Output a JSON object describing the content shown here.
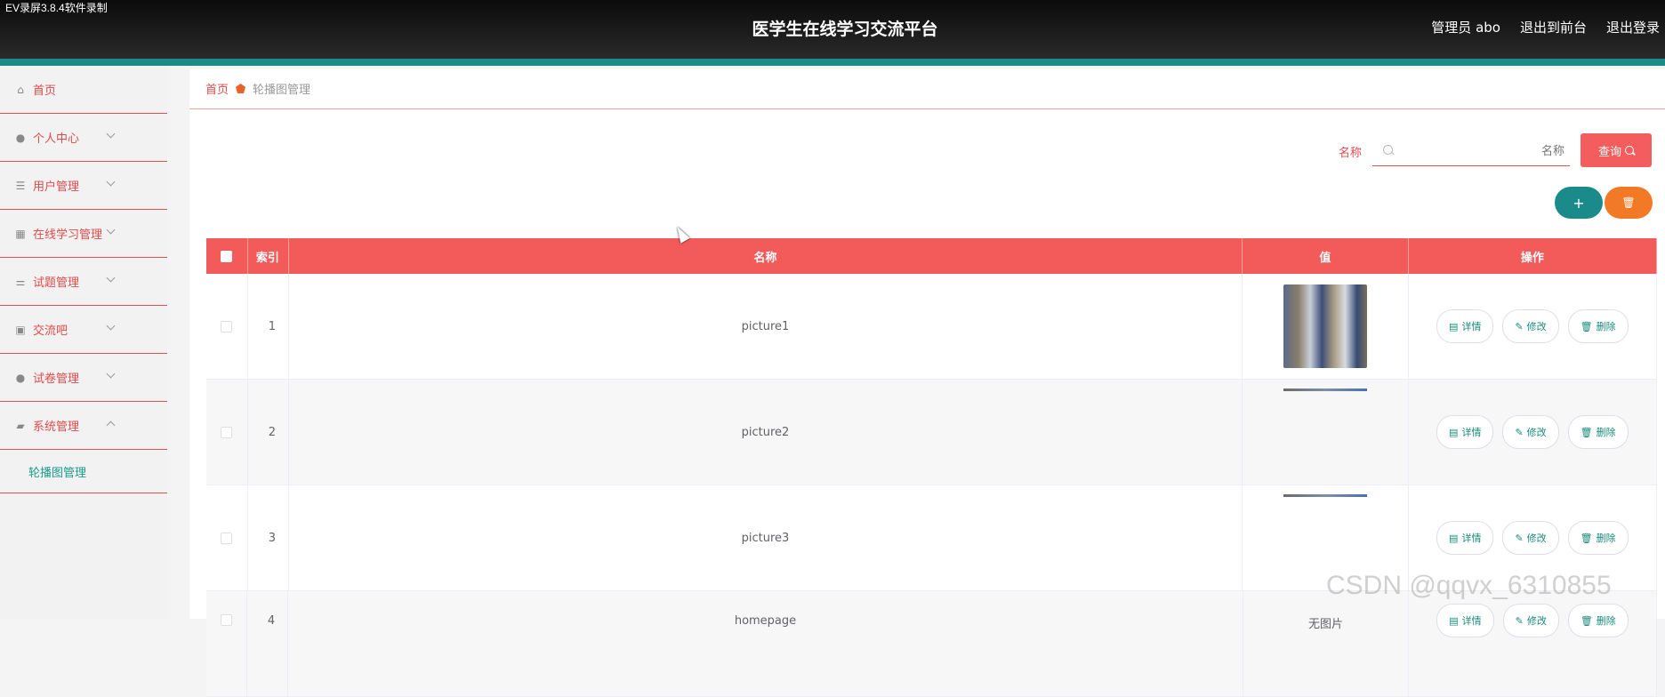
{
  "recorder_label": "EV录屏3.8.4软件录制",
  "header": {
    "title": "医学生在线学习交流平台",
    "user": "管理员 abo",
    "to_front": "退出到前台",
    "logout": "退出登录"
  },
  "sidebar": {
    "items": [
      {
        "label": "首页",
        "icon": "home-icon"
      },
      {
        "label": "个人中心",
        "icon": "person-icon"
      },
      {
        "label": "用户管理",
        "icon": "list-icon"
      },
      {
        "label": "在线学习管理",
        "icon": "grid-icon"
      },
      {
        "label": "试题管理",
        "icon": "sliders-icon"
      },
      {
        "label": "交流吧",
        "icon": "clipboard-icon"
      },
      {
        "label": "试卷管理",
        "icon": "person-icon"
      },
      {
        "label": "系统管理",
        "icon": "wallet-icon"
      }
    ],
    "sub_item": "轮播图管理"
  },
  "breadcrumb": {
    "home": "首页",
    "current": "轮播图管理"
  },
  "search": {
    "label": "名称",
    "placeholder": "名称",
    "button": "查询"
  },
  "actions": {
    "add": "+",
    "delete": "🗑"
  },
  "table": {
    "headers": {
      "index": "索引",
      "name": "名称",
      "value": "值",
      "ops": "操作"
    },
    "buttons": {
      "detail": "详情",
      "edit": "修改",
      "delete": "删除"
    },
    "rows": [
      {
        "index": "1",
        "name": "picture1"
      },
      {
        "index": "2",
        "name": "picture2"
      },
      {
        "index": "3",
        "name": "picture3"
      },
      {
        "index": "4",
        "name": "homepage",
        "value_text": "无图片"
      }
    ]
  },
  "watermark": "CSDN @qqvx_6310855"
}
